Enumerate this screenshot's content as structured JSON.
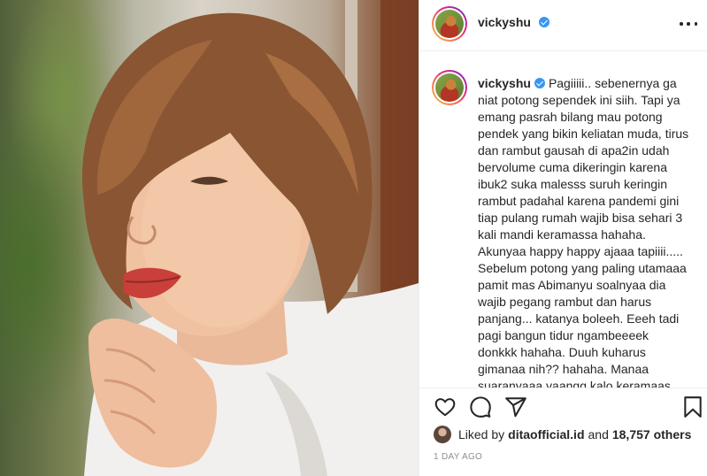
{
  "post": {
    "username": "vickyshu",
    "verified": true,
    "caption_username": "vickyshu",
    "caption": "Pagiiiii.. sebenernya ga\nniat potong sependek ini siih. Tapi ya\nemang pasrah bilang mau potong\npendek yang bikin keliatan muda, tirus\ndan rambut gausah di apa2in udah\nbervolume cuma dikeringin karena\nibuk2 suka malesss suruh keringin\nrambut padahal karena pandemi gini\ntiap pulang rumah wajib bisa sehari 3\nkali mandi keramassa hahaha.\nAkunyaa happy happy ajaaa tapiiii.....\nSebelum potong yang paling utamaaa\npamit mas Abimanyu soalnyaa dia\nwajib pegang rambut dan harus\npanjang... katanya boleeh. Eeeh tadi\npagi bangun tidur ngambeeeek\ndonkkk hahaha. Duuh kuharus\ngimanaa nih?? hahaha. Manaa\nsuaranyaaa yaangg kalo keramaas",
    "liked_by_prefix": "Liked by",
    "liked_by_user": "ditaofficial.id",
    "liked_by_and": "and",
    "others_count": "18,757 others",
    "timestamp": "1 DAY AGO"
  },
  "icons": {
    "more": "more-options-icon",
    "verified": "verified-badge-icon",
    "like": "heart-icon",
    "comment": "comment-icon",
    "share": "share-icon",
    "save": "bookmark-icon"
  },
  "colors": {
    "text": "#262626",
    "muted": "#8e8e8e",
    "verified": "#3897f0",
    "divider": "#efefef"
  }
}
